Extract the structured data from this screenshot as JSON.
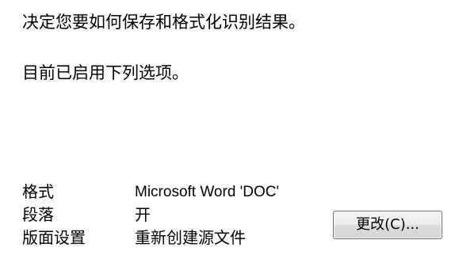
{
  "instruction_text": "决定您要如何保存和格式化识别结果。",
  "status_text": "目前已启用下列选项。",
  "settings": [
    {
      "label": "格式",
      "value": "Microsoft Word 'DOC'"
    },
    {
      "label": "段落",
      "value": "开"
    },
    {
      "label": "版面设置",
      "value": "重新创建源文件"
    }
  ],
  "change_button_label": "更改(C)..."
}
